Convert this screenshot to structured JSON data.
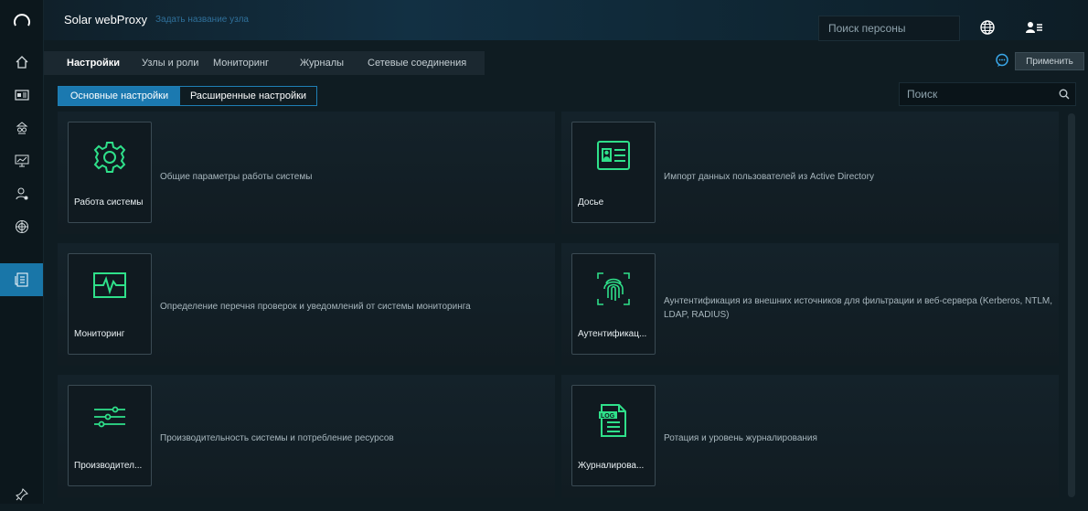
{
  "header": {
    "brand": "Solar webProxy",
    "node_name_placeholder": "Задать название узла",
    "person_search_placeholder": "Поиск персоны"
  },
  "sidebar": {
    "items": [
      {
        "icon": "home-icon"
      },
      {
        "icon": "dossier-icon"
      },
      {
        "icon": "spy-icon"
      },
      {
        "icon": "monitor-chart-icon"
      },
      {
        "icon": "user-settings-icon"
      },
      {
        "icon": "globe-network-icon"
      },
      {
        "icon": "settings-doc-icon",
        "active": true
      }
    ],
    "bottom_icon": "pin-icon"
  },
  "tabs": [
    {
      "label": "Настройки",
      "active": true
    },
    {
      "label": "Узлы и роли"
    },
    {
      "label": "Мониторинг"
    },
    {
      "label": "Журналы"
    },
    {
      "label": "Сетевые соединения"
    }
  ],
  "apply_label": "Применить",
  "subtabs": [
    {
      "label": "Основные настройки",
      "active": true
    },
    {
      "label": "Расширенные настройки"
    }
  ],
  "search_placeholder": "Поиск",
  "cards": [
    {
      "label": "Работа системы",
      "description": "Общие параметры работы системы",
      "icon": "gear-icon"
    },
    {
      "label": "Досье",
      "description": "Импорт данных пользователей из Active Directory",
      "icon": "id-card-icon"
    },
    {
      "label": "Мониторинг",
      "description": "Определение перечня проверок и уведомлений от системы мониторинга",
      "icon": "heartbeat-monitor-icon"
    },
    {
      "label": "Аутентификац...",
      "description": "Аунтентификация из внешних источников для фильтрации и веб-сервера (Kerberos, NTLM, LDAP, RADIUS)",
      "icon": "fingerprint-icon"
    },
    {
      "label": "Производител...",
      "description": "Производительность системы и потребление ресурсов",
      "icon": "sliders-icon"
    },
    {
      "label": "Журналирова...",
      "description": "Ротация и уровень журналирования",
      "icon": "log-file-icon"
    }
  ],
  "colors": {
    "accent": "#1b79b0",
    "icon_green": "#2fe08a",
    "background": "#0f1c22"
  }
}
